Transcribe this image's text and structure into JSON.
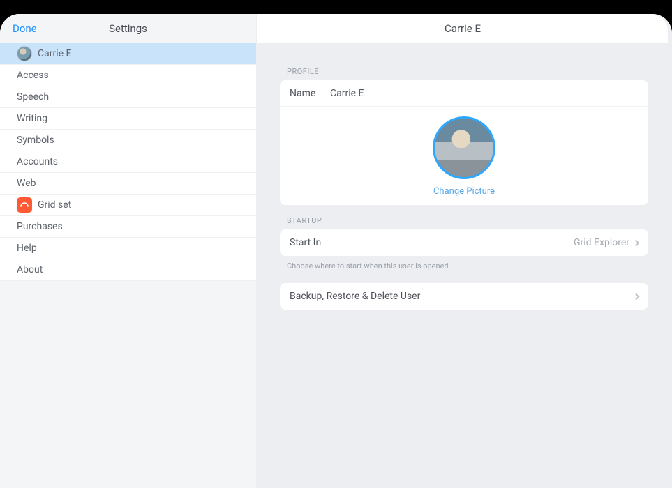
{
  "header": {
    "done": "Done",
    "sidebar_title": "Settings",
    "main_title": "Carrie E"
  },
  "sidebar": {
    "items": [
      {
        "label": "Carrie E",
        "icon": "avatar"
      },
      {
        "label": "Access"
      },
      {
        "label": "Speech"
      },
      {
        "label": "Writing"
      },
      {
        "label": "Symbols"
      },
      {
        "label": "Accounts"
      },
      {
        "label": "Web"
      },
      {
        "label": "Grid set",
        "icon": "grid"
      },
      {
        "label": "Purchases"
      },
      {
        "label": "Help"
      },
      {
        "label": "About"
      }
    ]
  },
  "profile": {
    "section_label": "PROFILE",
    "name_label": "Name",
    "name_value": "Carrie E",
    "change_picture": "Change Picture"
  },
  "startup": {
    "section_label": "STARTUP",
    "start_in_label": "Start In",
    "start_in_value": "Grid Explorer",
    "hint": "Choose where to start when this user is opened."
  },
  "backup": {
    "label": "Backup, Restore & Delete User"
  }
}
